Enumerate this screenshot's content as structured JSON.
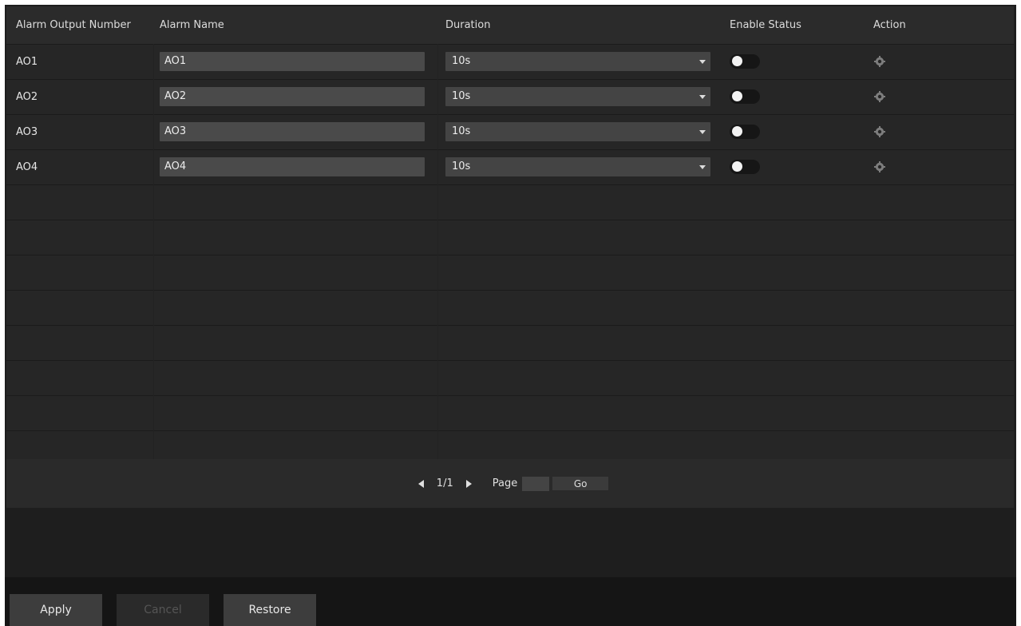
{
  "table": {
    "headers": {
      "number": "Alarm Output Number",
      "name": "Alarm Name",
      "duration": "Duration",
      "enable": "Enable Status",
      "action": "Action"
    },
    "rows": [
      {
        "number": "AO1",
        "name": "AO1",
        "duration": "10s",
        "enabled": false,
        "action_icon": "gear-icon"
      },
      {
        "number": "AO2",
        "name": "AO2",
        "duration": "10s",
        "enabled": false,
        "action_icon": "gear-icon"
      },
      {
        "number": "AO3",
        "name": "AO3",
        "duration": "10s",
        "enabled": false,
        "action_icon": "gear-icon"
      },
      {
        "number": "AO4",
        "name": "AO4",
        "duration": "10s",
        "enabled": false,
        "action_icon": "gear-icon"
      }
    ]
  },
  "pager": {
    "current": "1/1",
    "page_label": "Page",
    "page_value": "",
    "go_label": "Go"
  },
  "footer": {
    "apply_label": "Apply",
    "cancel_label": "Cancel",
    "restore_label": "Restore"
  }
}
